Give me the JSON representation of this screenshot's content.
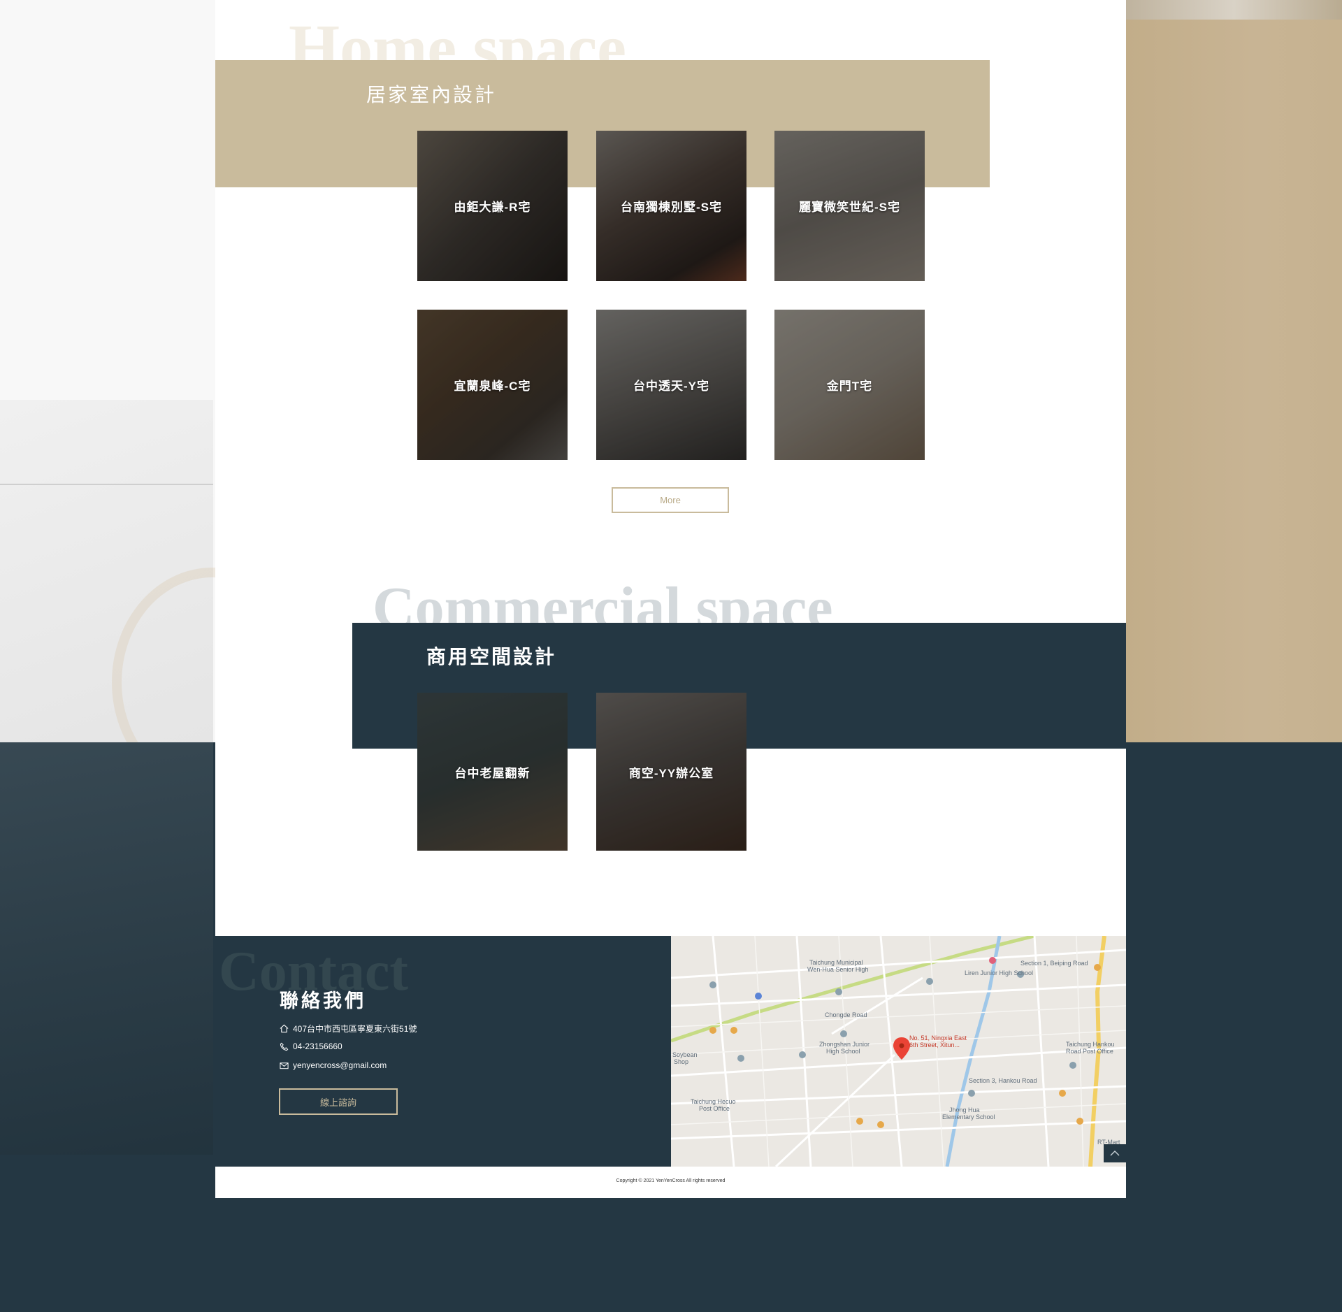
{
  "home_section": {
    "watermark": "Home space",
    "title": "居家室內設計",
    "projects": [
      {
        "label": "由鉅大謙-R宅"
      },
      {
        "label": "台南獨棟別墅-S宅"
      },
      {
        "label": "麗寶微笑世紀-S宅"
      },
      {
        "label": "宜蘭泉峰-C宅"
      },
      {
        "label": "台中透天-Y宅"
      },
      {
        "label": "金門T宅"
      }
    ],
    "more_label": "More"
  },
  "commercial_section": {
    "watermark": "Commercial space",
    "title": "商用空間設計",
    "projects": [
      {
        "label": "台中老屋翻新"
      },
      {
        "label": "商空-YY辦公室"
      }
    ]
  },
  "contact": {
    "watermark": "Contact",
    "title": "聯絡我們",
    "address": "407台中市西屯區寧夏東六街51號",
    "phone": "04-23156660",
    "email": "yenyencross@gmail.com",
    "consult_label": "線上諮詢",
    "icons": [
      "home-icon",
      "phone-icon",
      "mail-icon"
    ]
  },
  "map": {
    "pin_label_1": "No. 51, Ningxia East",
    "pin_label_2": "6th Street, Xitun...",
    "labels": [
      "Taichung Municipal",
      "Wen-Hua Senior High",
      "Liren Junior High School",
      "Zhongshan Junior",
      "High School",
      "Section 1, Beiping Road",
      "Section 3, Hankou Road",
      "Jhong Hua",
      "Elementary School",
      "Taichung Hankou",
      "Road Post Office",
      "Taichung Hecuo",
      "Post Office",
      "Soybean",
      "Shop",
      "RT-Mart",
      "Chongde Road"
    ]
  },
  "footer": {
    "copyright": "Copyright © 2021 YenYenCross All rights reserved"
  },
  "colors": {
    "tan": "#c9bb9c",
    "navy": "#243743",
    "white": "#ffffff"
  }
}
